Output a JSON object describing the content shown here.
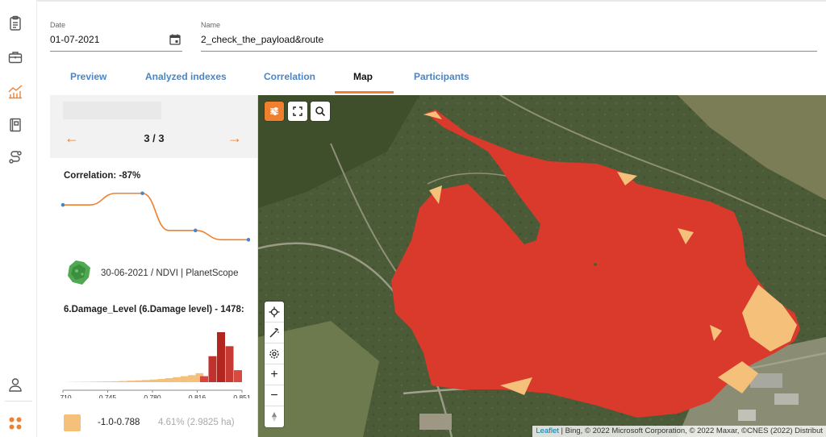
{
  "header": {
    "date_label": "Date",
    "date_value": "01-07-2021",
    "name_label": "Name",
    "name_value": "2_check_the_payload&route"
  },
  "tabs": [
    {
      "label": "Preview"
    },
    {
      "label": "Analyzed indexes"
    },
    {
      "label": "Correlation"
    },
    {
      "label": "Map",
      "active": true
    },
    {
      "label": "Participants"
    }
  ],
  "panel": {
    "prev_arrow": "←",
    "next_arrow": "→",
    "pager": "3 / 3",
    "correlation_label": "Correlation: -87%",
    "correlation_points": [
      0.28,
      0.28,
      0.08,
      0.08,
      0.72,
      0.72,
      0.88,
      0.88
    ],
    "correlation_markers": [
      0,
      3,
      5,
      7
    ],
    "source_text": "30-06-2021 / NDVI | PlanetScope",
    "damage_title": "6.Damage_Level (6.Damage level) - 1478:",
    "legend_range": "-1.0-0.788",
    "legend_pct": "4.61% (2.9825 ha)"
  },
  "chart_data": {
    "type": "bar",
    "title": "",
    "x_ticks": [
      "0.710",
      "0.745",
      "0.780",
      "0.816",
      "0.851"
    ],
    "xlim": [
      0.71,
      0.851
    ],
    "bins_low": [
      0.3,
      0.5,
      0.7,
      0.9,
      1.2,
      1.5,
      1.9,
      2.4,
      3.0,
      3.6,
      4.4,
      5.3,
      6.5,
      8,
      10,
      12,
      14,
      18
    ],
    "bins_high": [
      {
        "color": "#d9453a",
        "value": 12
      },
      {
        "color": "#c0322b",
        "value": 52
      },
      {
        "color": "#b32620",
        "value": 100
      },
      {
        "color": "#c53b34",
        "value": 72
      },
      {
        "color": "#d64a40",
        "value": 24
      }
    ]
  },
  "map": {
    "attribution_link": "Leaflet",
    "attribution_text": " | Bing, © 2022 Microsoft Corporation, © 2022 Maxar, ©CNES (2022) Distribut",
    "zoom_in": "+",
    "zoom_out": "−"
  },
  "colors": {
    "accent": "#f07f2e",
    "tab_link": "#4a86c6",
    "damage_high": "#d93a2b",
    "damage_low": "#f5c07a",
    "vegetation": "#4c5b37"
  }
}
